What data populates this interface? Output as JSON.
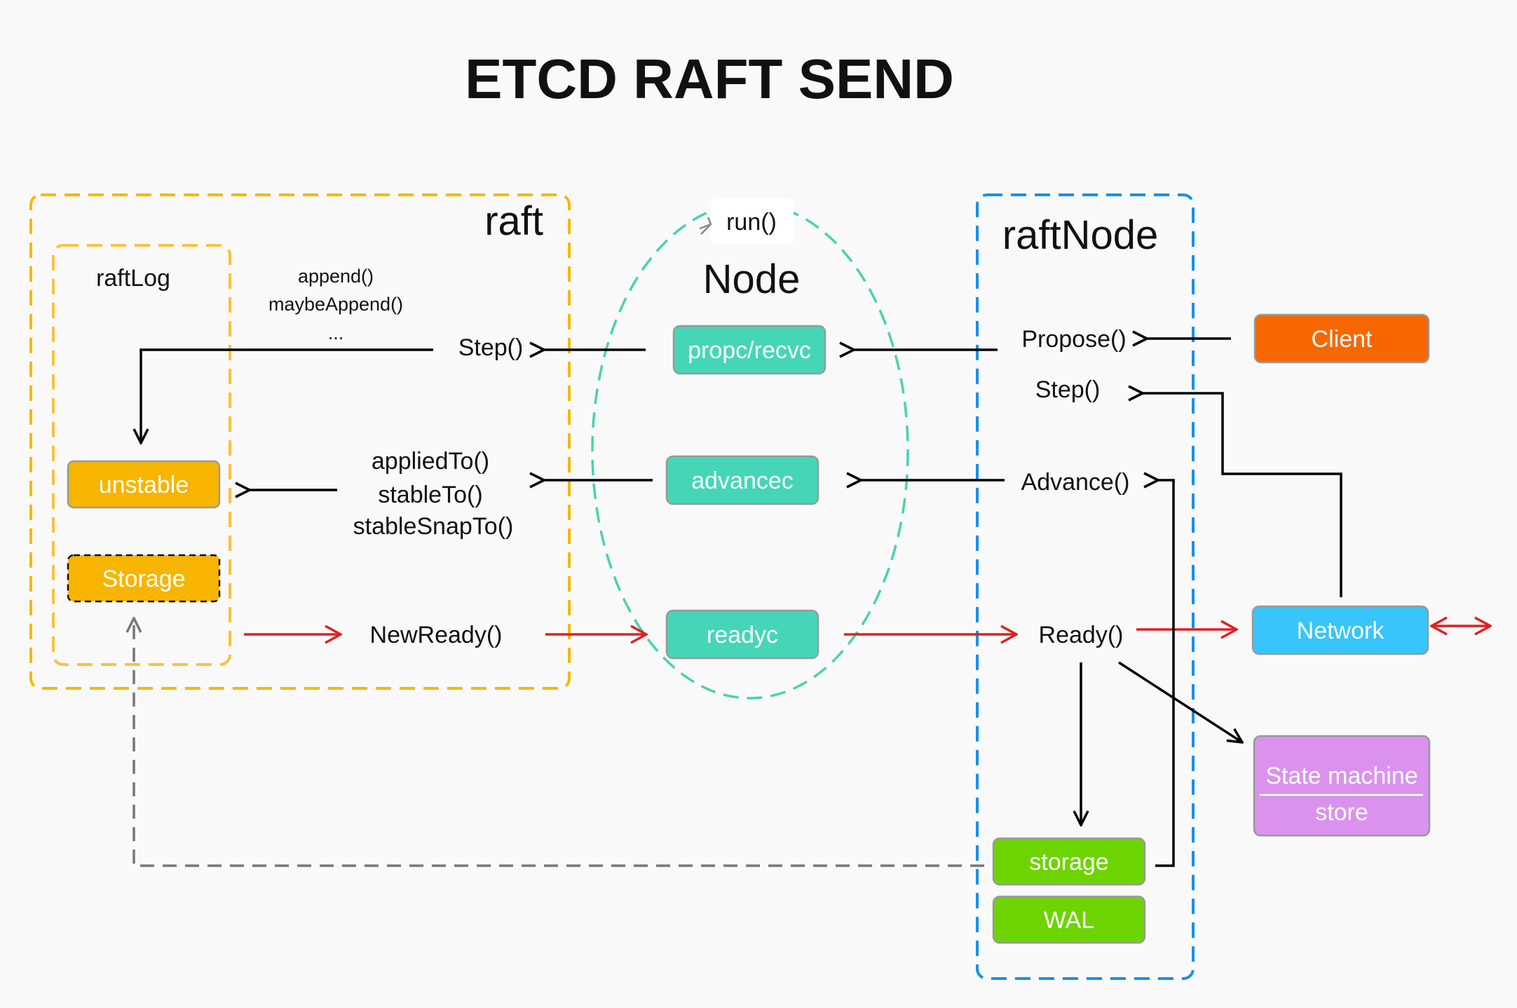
{
  "title": "ETCD RAFT SEND",
  "colors": {
    "raft_border": "#f5b800",
    "raftnode_border": "#1a8fe8",
    "node_ellipse": "#48d2b2",
    "yellow_box": "#f7b500",
    "teal_box": "#45d6b7",
    "orange_box": "#f76700",
    "blue_box": "#37c5fb",
    "purple_box": "#da92ee",
    "green_box": "#6dd400",
    "red_arrow": "#e02020",
    "gray_dashed": "#777777"
  },
  "raft": {
    "label": "raft",
    "raftlog": {
      "label": "raftLog",
      "unstable": "unstable",
      "storage": "Storage"
    },
    "append_methods": [
      "append()",
      "maybeAppend()",
      "..."
    ],
    "step": "Step()",
    "stable_methods": [
      "appliedTo()",
      "stableTo()",
      "stableSnapTo()"
    ],
    "new_ready": "NewReady()"
  },
  "node": {
    "run": "run()",
    "label": "Node",
    "channels": {
      "propc": "propc/recvc",
      "advancec": "advancec",
      "readyc": "readyc"
    }
  },
  "raftnode": {
    "label": "raftNode",
    "propose": "Propose()",
    "step": "Step()",
    "advance": "Advance()",
    "ready": "Ready()",
    "storage": "storage",
    "wal": "WAL"
  },
  "external": {
    "client": "Client",
    "network": "Network",
    "state_machine": "State machine",
    "store": "store"
  }
}
